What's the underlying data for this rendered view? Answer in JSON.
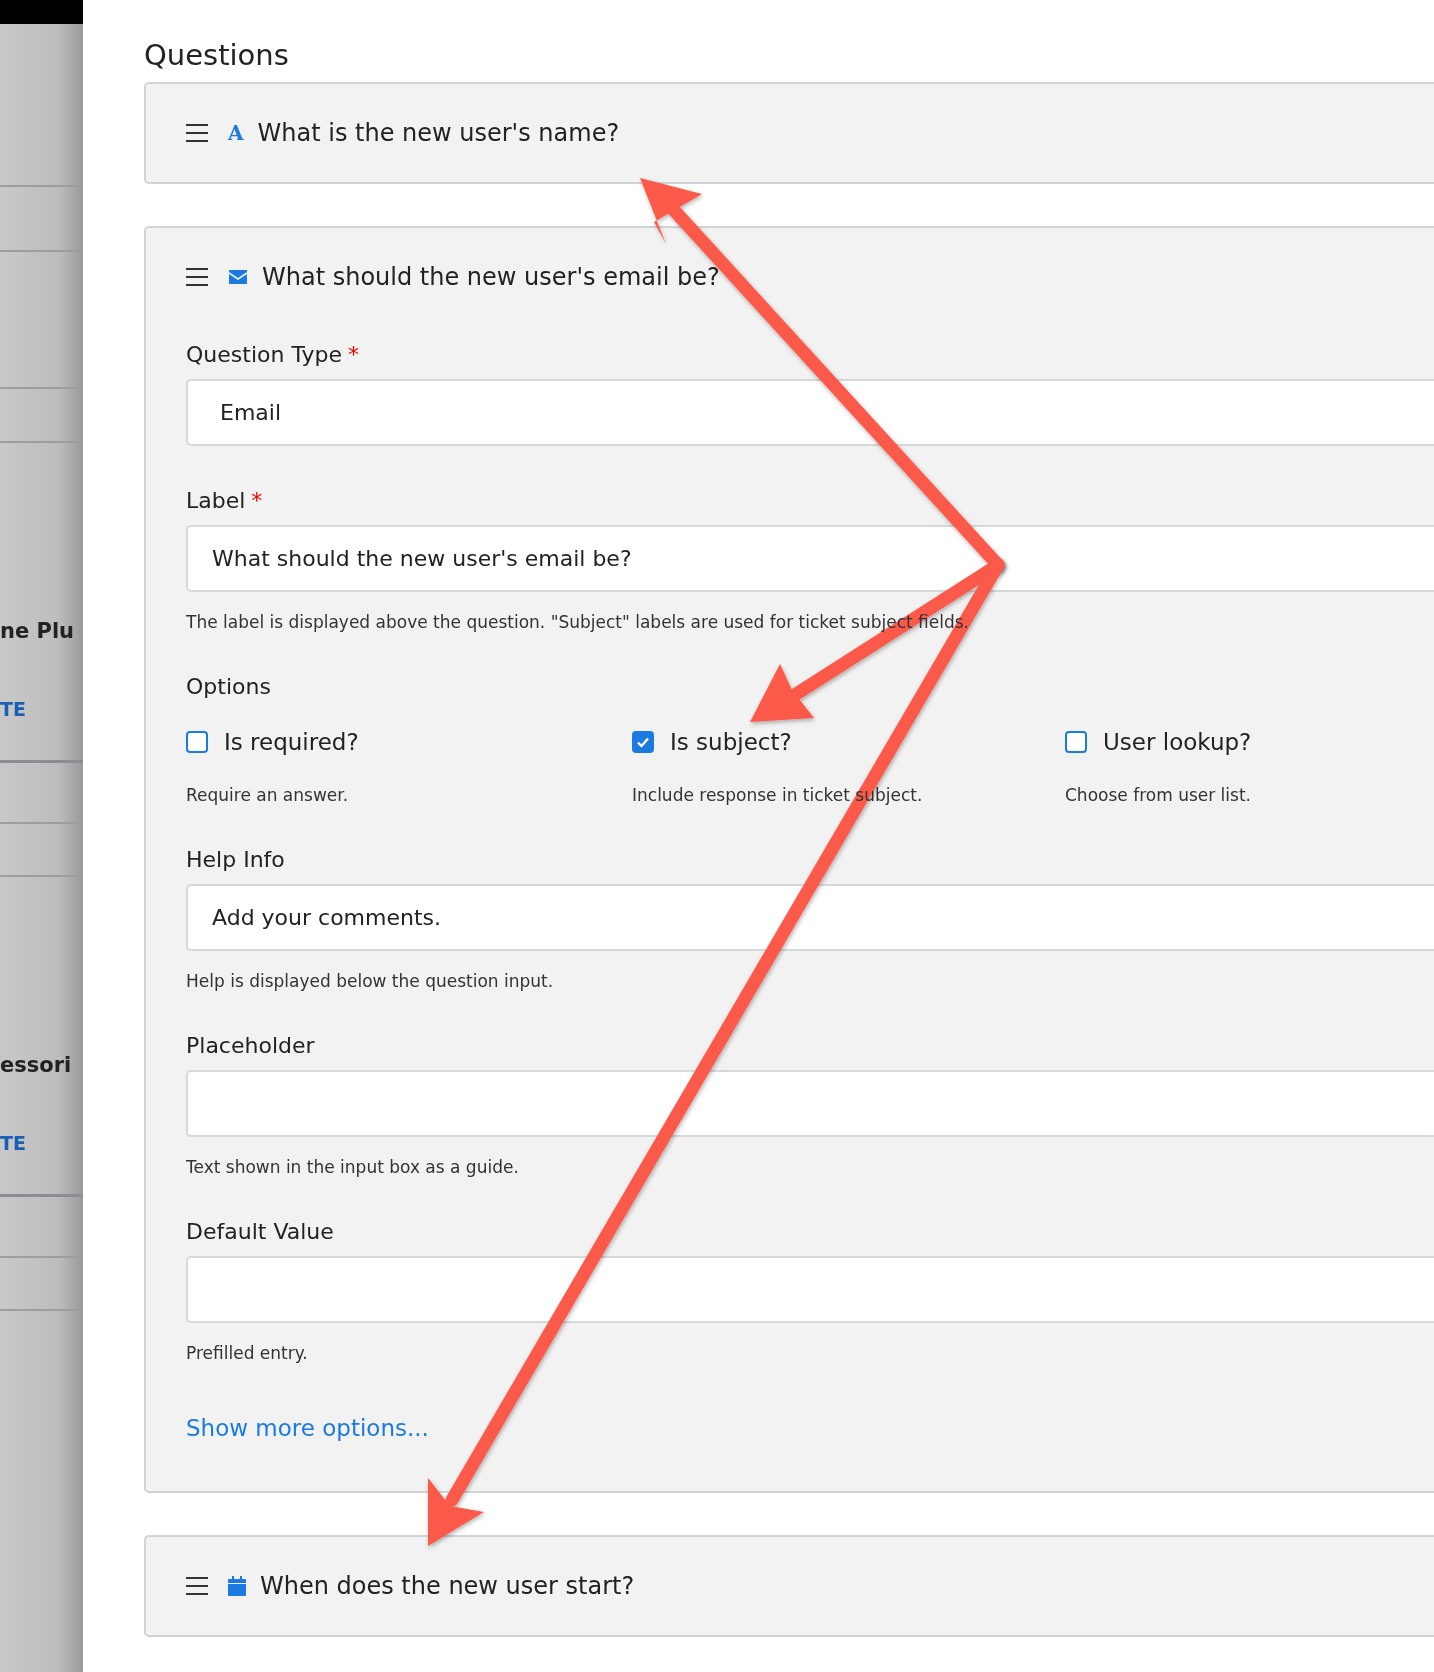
{
  "sidebar": {
    "items": [
      {
        "kind": "title",
        "text": "ne Plu"
      },
      {
        "kind": "link",
        "text": "TE"
      },
      {
        "kind": "title",
        "text": "essori"
      },
      {
        "kind": "link",
        "text": "TE"
      }
    ]
  },
  "heading": "Questions",
  "questions": [
    {
      "kind": "text",
      "icon_text": "A",
      "title": "What is the new user's name?"
    },
    {
      "kind": "email",
      "title": "What should the new user's email be?",
      "editor": {
        "question_type": {
          "label": "Question Type",
          "required_mark": "*",
          "value": "Email"
        },
        "label_field": {
          "label": "Label",
          "required_mark": "*",
          "value": "What should the new user's email be?",
          "help": "The label is displayed above the question. \"Subject\" labels are used for ticket subject fields."
        },
        "options_heading": "Options",
        "options": [
          {
            "label": "Is required?",
            "description": "Require an answer.",
            "checked": false
          },
          {
            "label": "Is subject?",
            "description": "Include response in ticket subject.",
            "checked": true
          },
          {
            "label": "User lookup?",
            "description": "Choose from user list.",
            "checked": false
          }
        ],
        "fields": [
          {
            "label": "Help Info",
            "value": "Add your comments.",
            "help": "Help is displayed below the question input."
          },
          {
            "label": "Placeholder",
            "help": "Text shown in the input box as a guide."
          },
          {
            "label": "Default Value",
            "help": "Prefilled entry."
          }
        ],
        "more_link": "Show more options..."
      }
    },
    {
      "kind": "date",
      "title": "When does the new user start?"
    }
  ]
}
